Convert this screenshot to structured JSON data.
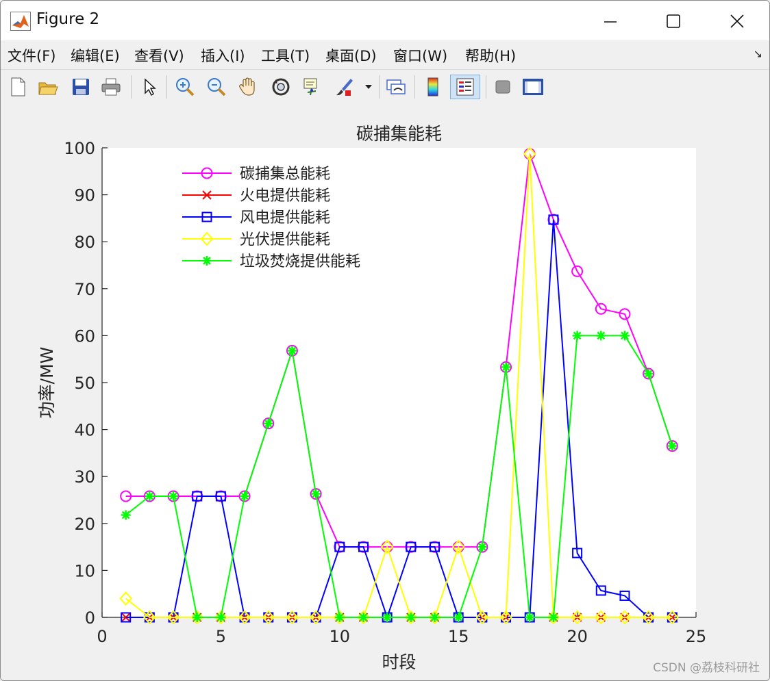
{
  "window": {
    "title": "Figure 2"
  },
  "menu": [
    "文件(F)",
    "编辑(E)",
    "查看(V)",
    "插入(I)",
    "工具(T)",
    "桌面(D)",
    "窗口(W)",
    "帮助(H)"
  ],
  "toolbar_icons": [
    "new-figure-icon",
    "open-file-icon",
    "save-icon",
    "print-icon",
    "edit-plot-arrow-icon",
    "zoom-in-icon",
    "zoom-out-icon",
    "pan-hand-icon",
    "rotate-3d-icon",
    "data-cursor-icon",
    "brush-icon",
    "link-plot-icon",
    "colorbar-icon",
    "legend-icon",
    "hide-plot-tools-icon",
    "show-plot-tools-icon"
  ],
  "watermark": "CSDN @荔枝科研社",
  "chart_data": {
    "type": "line",
    "title": "碳捕集能耗",
    "xlabel": "时段",
    "ylabel": "功率/MW",
    "xlim": [
      0,
      25
    ],
    "ylim": [
      0,
      100
    ],
    "xticks": [
      0,
      5,
      10,
      15,
      20,
      25
    ],
    "yticks": [
      0,
      10,
      20,
      30,
      40,
      50,
      60,
      70,
      80,
      90,
      100
    ],
    "grid": false,
    "legend_position": "top-left",
    "x": [
      1,
      2,
      3,
      4,
      5,
      6,
      7,
      8,
      9,
      10,
      11,
      12,
      13,
      14,
      15,
      16,
      17,
      18,
      19,
      20,
      21,
      22,
      23,
      24
    ],
    "series": [
      {
        "name": "碳捕集总能耗",
        "color": "#ff00ff",
        "marker": "circle",
        "values": [
          25.8,
          25.8,
          25.8,
          25.8,
          25.8,
          25.8,
          41.3,
          56.8,
          26.3,
          15,
          15,
          15,
          15,
          15,
          15,
          15,
          53.3,
          98.7,
          84.7,
          73.7,
          65.7,
          64.6,
          51.9,
          36.5
        ]
      },
      {
        "name": "火电提供能耗",
        "color": "#ff0000",
        "marker": "x",
        "values": [
          0,
          0,
          0,
          0,
          0,
          0,
          0,
          0,
          0,
          0,
          0,
          0,
          0,
          0,
          0,
          0,
          0,
          0,
          0,
          0,
          0,
          0,
          0,
          0
        ]
      },
      {
        "name": "风电提供能耗",
        "color": "#0000ff",
        "marker": "square",
        "values": [
          0,
          0,
          0,
          25.8,
          25.8,
          0,
          0,
          0,
          0,
          15,
          15,
          0,
          15,
          15,
          0,
          0,
          0,
          0,
          84.7,
          13.7,
          5.7,
          4.6,
          0,
          0
        ]
      },
      {
        "name": "光伏提供能耗",
        "color": "#ffff00",
        "marker": "diamond",
        "values": [
          4,
          0,
          0,
          0,
          0,
          0,
          0,
          0,
          0,
          0,
          0,
          15,
          0,
          0,
          15,
          0,
          0,
          98.7,
          0,
          0,
          0,
          0,
          0,
          0
        ]
      },
      {
        "name": "垃圾焚烧提供能耗",
        "color": "#00ff00",
        "marker": "star",
        "values": [
          21.8,
          25.8,
          25.8,
          0,
          0,
          25.8,
          41.3,
          56.8,
          26.3,
          0,
          0,
          0,
          0,
          0,
          0,
          15,
          53.3,
          0,
          0,
          60,
          60,
          60,
          51.9,
          36.5
        ]
      }
    ]
  }
}
